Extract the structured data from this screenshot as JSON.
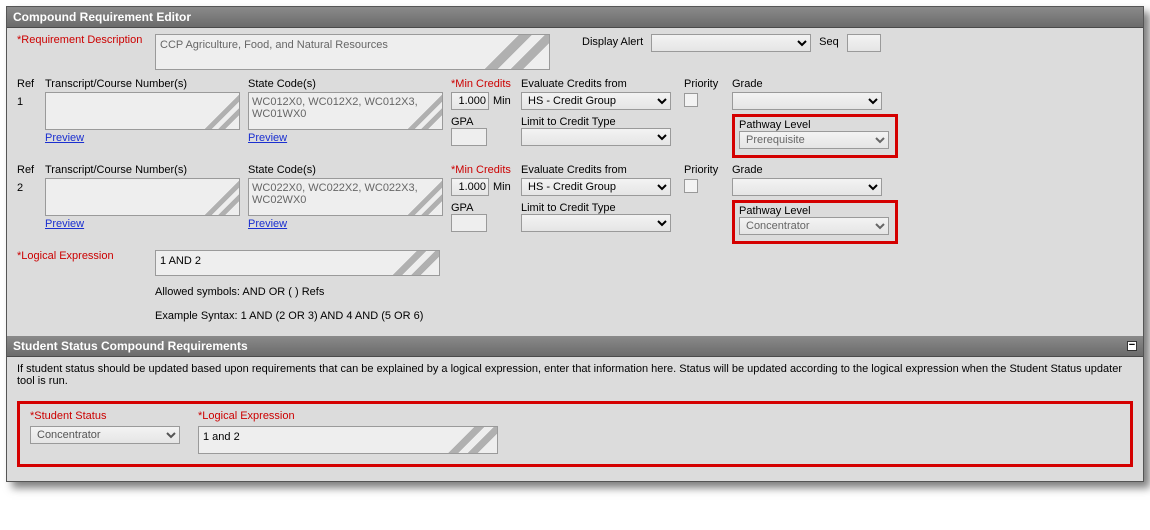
{
  "editor": {
    "title": "Compound Requirement Editor",
    "reqDescLabel": "*Requirement Description",
    "reqDescValue": "CCP Agriculture, Food, and Natural Resources",
    "displayAlertLabel": "Display Alert",
    "seqLabel": "Seq"
  },
  "cols": {
    "refHdr": "Ref",
    "tcHdr": "Transcript/Course Number(s)",
    "stateHdr": "State Code(s)",
    "minCreditsHdr": "*Min Credits",
    "evalHdr": "Evaluate Credits from",
    "priorityHdr": "Priority",
    "gradeHdr": "Grade",
    "gpaLbl": "GPA",
    "limitLbl": "Limit to Credit Type",
    "pathwayLbl": "Pathway Level",
    "minSuffix": "Min",
    "previewLink": "Preview",
    "evalFromOption": "HS - Credit Group"
  },
  "rows": [
    {
      "ref": "1",
      "stateCodes": "WC012X0, WC012X2, WC012X3, WC01WX0",
      "minCredits": "1.000",
      "pathwayLevel": "Prerequisite"
    },
    {
      "ref": "2",
      "stateCodes": "WC022X0, WC022X2, WC022X3, WC02WX0",
      "minCredits": "1.000",
      "pathwayLevel": "Concentrator"
    }
  ],
  "logic": {
    "logicalExprLabel": "*Logical Expression",
    "val": "1 AND 2",
    "allowed": "Allowed symbols: AND OR ( ) Refs",
    "example": "Example Syntax: 1 AND (2 OR 3) AND 4 AND (5 OR 6)"
  },
  "sscr": {
    "title": "Student Status Compound Requirements",
    "desc": "If student status should be updated based upon requirements that can be explained by a logical expression, enter that information here. Status will be updated according to the logical expression when the Student Status updater tool is run.",
    "studentStatusLabel": "*Student Status",
    "logicalExprLabel": "*Logical Expression",
    "studentStatusVal": "Concentrator",
    "exprVal": "1 and 2"
  }
}
